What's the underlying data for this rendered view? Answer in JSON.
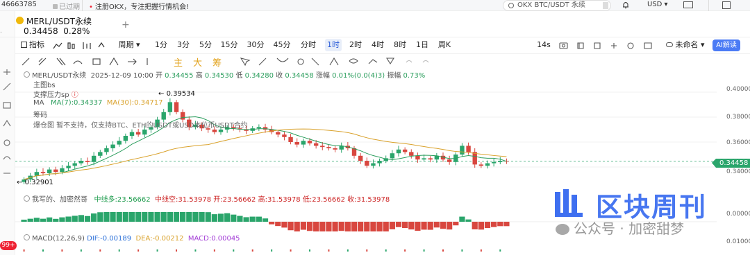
{
  "topbar": {
    "account_id": "46663785",
    "expired_label": "已过期",
    "notice": "注册OKX，专注把握行情机会!",
    "search_placeholder": "OKX BTC/USDT 永续",
    "currency": "USD"
  },
  "symbol": {
    "name": "MERL/USDT永续",
    "price": "0.34458",
    "change_pct": "0.28%"
  },
  "toolbar": {
    "indicators_label": "指标",
    "period_label": "周期",
    "timeframes": [
      "1分",
      "3分",
      "5分",
      "15分",
      "30分",
      "45分",
      "分时",
      "1时",
      "2时",
      "4时",
      "8时",
      "1日",
      "周K"
    ],
    "active_timeframe": "1时",
    "countdown": "14s",
    "layout_name": "未命名",
    "ai_label": "AI解读",
    "draw_tools": [
      "主",
      "大",
      "筹"
    ]
  },
  "legend": {
    "title": "MERL/USDT永续",
    "datetime": "2025-12-09 10:00",
    "open_label": "开",
    "open": "0.34455",
    "high_label": "高",
    "high": "0.34530",
    "low_label": "低",
    "low": "0.34280",
    "close_label": "收",
    "close": "0.34458",
    "change_label": "涨幅",
    "change": "0.01%(0.0(4)3)",
    "amp_label": "振幅",
    "amp": "0.73%"
  },
  "overlays": {
    "main_bs": "主图bs",
    "support": "支撑压力sp",
    "ma_label": "MA",
    "ma7": "MA(7):0.34337",
    "ma30": "MA(30):0.34717",
    "chips": "筹码",
    "liq_note": "爆仓图 暂不支持，仅支持BTC、ETH的USDT或USD本位币USDT合约"
  },
  "annotations": {
    "high_mark": "0.39534",
    "low_mark": "0.32901"
  },
  "price_axis": {
    "ticks": [
      "0.40000",
      "0.38000",
      "0.36000",
      "0.34458",
      "0.34000"
    ],
    "current": "0.34458"
  },
  "indicator2": {
    "name": "我写的、加密然哥",
    "long_label": "中线多",
    "long": "23.56662",
    "short_label": "中线空",
    "short": "31.53978",
    "open_label": "开",
    "open": "23.56662",
    "high_label": "高",
    "high": "31.53978",
    "low_label": "低",
    "low": "23.56662",
    "close_label": "收",
    "close": "31.53978",
    "axis": "0.00000"
  },
  "macd": {
    "name": "MACD(12,26,9)",
    "dif": "DIF:-0.00189",
    "dea": "DEA:-0.00212",
    "macd": "MACD:0.00045",
    "axis": "0.01000"
  },
  "sidebar": {
    "badge": "99+"
  },
  "watermark": {
    "title": "区块周刊",
    "subtitle": "公众号 · 加密甜梦"
  },
  "colors": {
    "up": "#2aa56b",
    "down": "#d8473f",
    "accent": "#4b7bf5",
    "ma7": "#2a9d5c",
    "ma30": "#d9a12a"
  },
  "chart_data": {
    "type": "candlestick",
    "interval": "1时",
    "ylim": [
      0.325,
      0.405
    ],
    "y_ticks": [
      0.4,
      0.38,
      0.36,
      0.34
    ],
    "close_series": [
      0.33,
      0.333,
      0.336,
      0.335,
      0.338,
      0.336,
      0.339,
      0.341,
      0.343,
      0.345,
      0.344,
      0.349,
      0.352,
      0.355,
      0.358,
      0.361,
      0.365,
      0.368,
      0.366,
      0.37,
      0.372,
      0.378,
      0.384,
      0.392,
      0.384,
      0.378,
      0.372,
      0.374,
      0.371,
      0.37,
      0.368,
      0.37,
      0.372,
      0.371,
      0.37,
      0.369,
      0.371,
      0.372,
      0.37,
      0.368,
      0.366,
      0.364,
      0.36,
      0.358,
      0.361,
      0.359,
      0.357,
      0.356,
      0.355,
      0.354,
      0.357,
      0.355,
      0.349,
      0.345,
      0.341,
      0.343,
      0.345,
      0.347,
      0.351,
      0.354,
      0.352,
      0.349,
      0.346,
      0.347,
      0.346,
      0.349,
      0.346,
      0.344,
      0.35,
      0.357,
      0.352,
      0.342,
      0.341,
      0.343,
      0.344,
      0.345,
      0.3446
    ],
    "annotations": [
      {
        "label": "0.39534"
      },
      {
        "label": "0.32901"
      }
    ]
  }
}
